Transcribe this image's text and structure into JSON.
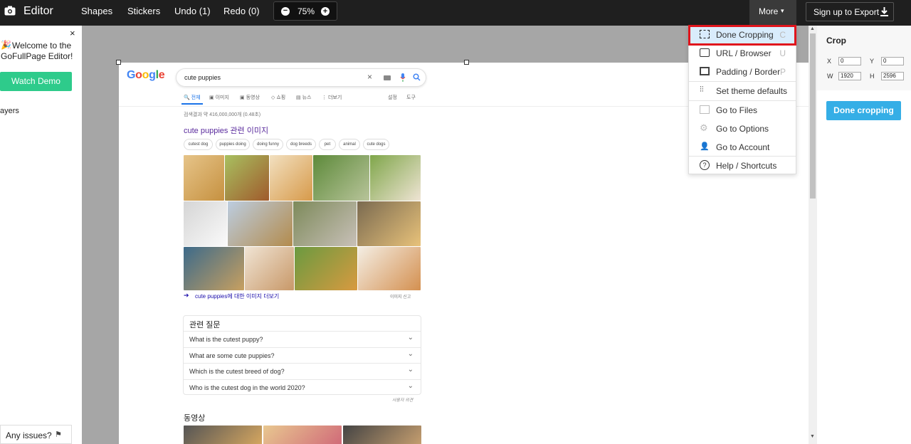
{
  "topbar": {
    "app_name": "Editor",
    "items": [
      "Shapes",
      "Stickers",
      "Undo (1)",
      "Redo (0)"
    ],
    "zoom": "75%",
    "more_label": "More",
    "export_label": "Sign up to Export"
  },
  "left_panel": {
    "welcome_line1": "Welcome to the",
    "welcome_line2": "GoFullPage Editor!",
    "watch_demo": "Watch Demo",
    "layers": "ayers",
    "any_issues": "Any issues?"
  },
  "right_panel": {
    "title": "Crop",
    "x_label": "X",
    "x_value": "0",
    "y_label": "Y",
    "y_value": "0",
    "w_label": "W",
    "w_value": "1920",
    "h_label": "H",
    "h_value": "2596",
    "done_button": "Done cropping"
  },
  "menu": {
    "items": [
      {
        "label": "Done Cropping",
        "shortcut": "C",
        "icon": "crop-dashed-icon"
      },
      {
        "label": "URL / Browser",
        "shortcut": "U",
        "icon": "browser-icon"
      },
      {
        "label": "Padding / Border",
        "shortcut": "P",
        "icon": "padding-icon"
      },
      {
        "label": "Set theme defaults",
        "shortcut": "",
        "icon": "sliders-icon"
      },
      {
        "label": "Go to Files",
        "shortcut": "",
        "icon": "files-icon"
      },
      {
        "label": "Go to Options",
        "shortcut": "",
        "icon": "gear-icon"
      },
      {
        "label": "Go to Account",
        "shortcut": "",
        "icon": "user-icon"
      },
      {
        "label": "Help / Shortcuts",
        "shortcut": "",
        "icon": "help-icon"
      }
    ],
    "highlight_color": "#d9ecfc",
    "highlight_border": "#e0141c"
  },
  "google": {
    "logo": "Google",
    "query": "cute puppies",
    "tabs": [
      "전체",
      "이미지",
      "동영상",
      "쇼핑",
      "뉴스",
      "더보기"
    ],
    "tab_right": [
      "설정",
      "도구"
    ],
    "result_count": "검색결과 약 416,000,000개 (0.48초)",
    "images_header": "cute puppies 관련 이미지",
    "chips": [
      "cutest dog",
      "puppies doing",
      "doing funny",
      "dog breeds",
      "pet",
      "animal",
      "cute dogs"
    ],
    "more_images": "cute puppies에 대한 이미지 더보기",
    "report": "이미지 신고",
    "related_title": "관련 질문",
    "questions": [
      "What is the cutest puppy?",
      "What are some cute puppies?",
      "Which is the cutest breed of dog?",
      "Who is the cutest dog in the world 2020?"
    ],
    "feedback": "사용자 의견",
    "videos_title": "동영상"
  },
  "colors": {
    "topbar_bg": "#1f1f1f",
    "accent_blue": "#35aee6",
    "watch_green": "#2ecb8b",
    "link_purple": "#5a2b9d"
  }
}
